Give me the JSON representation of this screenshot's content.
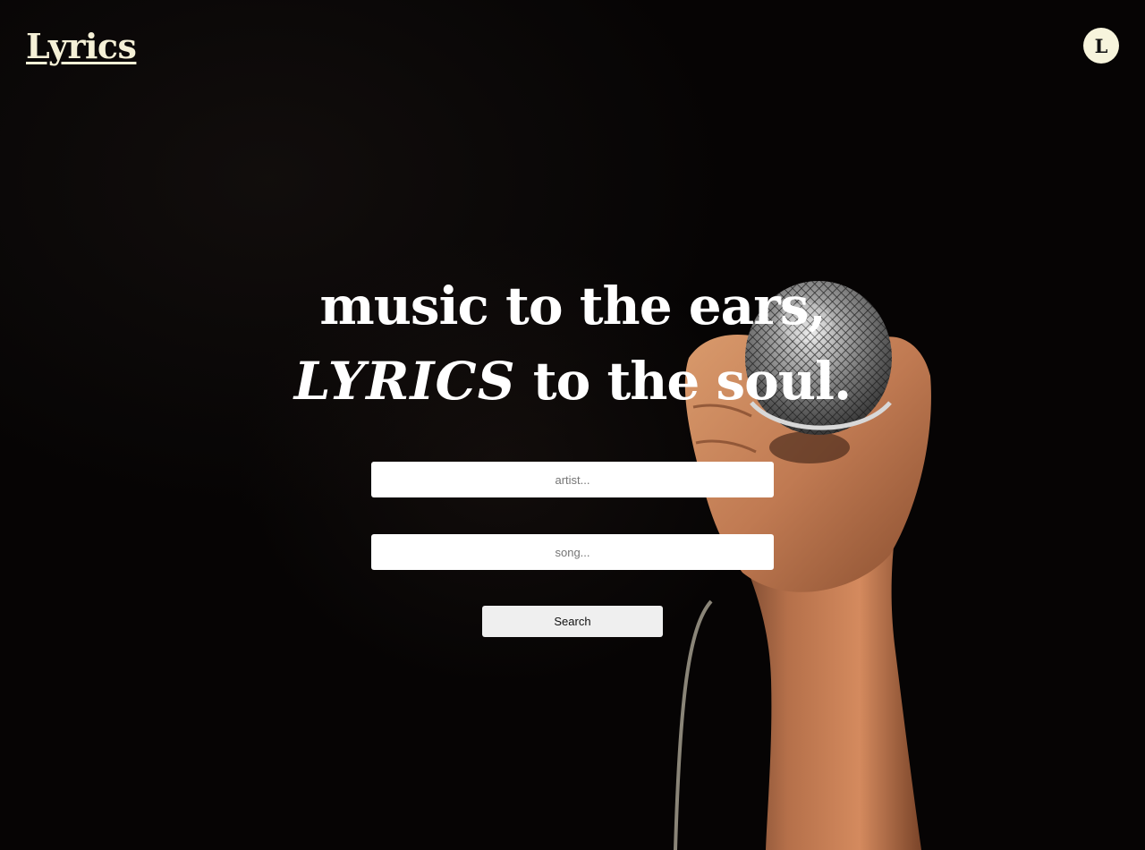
{
  "header": {
    "logo": "Lyrics",
    "avatar_letter": "L"
  },
  "hero": {
    "line1": "music to the ears,",
    "line2_emphasis": "LYRICS",
    "line2_rest": " to the soul."
  },
  "search": {
    "artist_placeholder": "artist...",
    "artist_value": "",
    "song_placeholder": "song...",
    "song_value": "",
    "button_label": "Search"
  },
  "colors": {
    "background": "#060404",
    "logo": "#f5f0d6",
    "avatar_bg": "#f7f4dc",
    "hero_text": "#ffffff",
    "button_bg": "#efefef"
  },
  "icons": {
    "background_image": "microphone-in-hand-photo"
  }
}
